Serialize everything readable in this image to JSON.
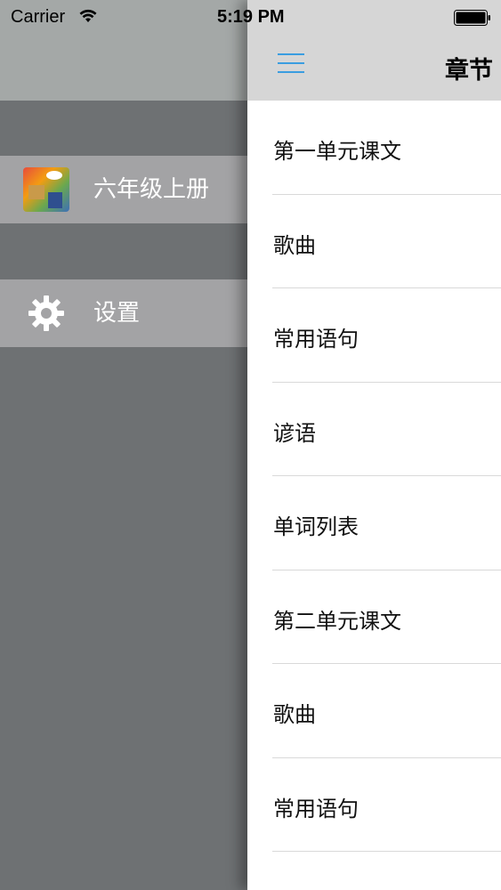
{
  "status_bar": {
    "carrier": "Carrier",
    "time": "5:19 PM"
  },
  "menu": {
    "items": [
      {
        "label": "六年级上册",
        "icon": "book-cover-icon"
      },
      {
        "label": "设置",
        "icon": "gear-icon"
      }
    ]
  },
  "nav": {
    "title": "章节",
    "menu_icon": "hamburger-menu-icon"
  },
  "chapters": [
    {
      "label": "第一单元课文"
    },
    {
      "label": "歌曲"
    },
    {
      "label": "常用语句"
    },
    {
      "label": "谚语"
    },
    {
      "label": "单词列表"
    },
    {
      "label": "第二单元课文"
    },
    {
      "label": "歌曲"
    },
    {
      "label": "常用语句"
    }
  ],
  "colors": {
    "accent": "#3a9de0",
    "menu_background": "#6e7173",
    "menu_item_background": "#a3a3a5",
    "nav_bar_background": "#d6d6d6"
  }
}
